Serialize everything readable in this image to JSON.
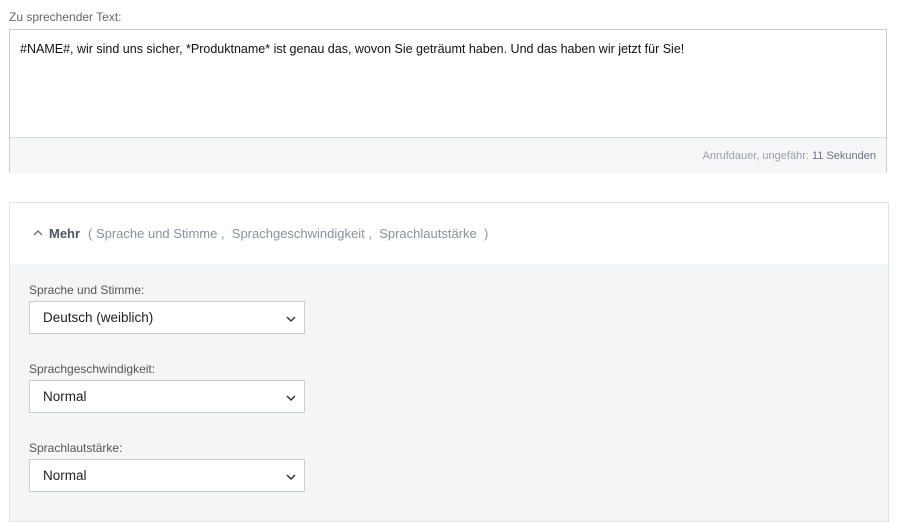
{
  "text_section": {
    "label": "Zu sprechender Text:",
    "text": "#NAME#, wir sind uns sicher, *Produktname* ist genau das, wovon Sie geträumt haben. Und das haben wir jetzt für Sie!",
    "duration_label": "Anrufdauer, ungefähr: ",
    "duration_value": "11 Sekunden"
  },
  "more": {
    "title": "Mehr",
    "summary": "( Sprache und Stimme ,  Sprachgeschwindigkeit ,  Sprachlautstärke  )",
    "expanded_icon": "chevron-up-icon"
  },
  "fields": [
    {
      "label": "Sprache und Stimme:",
      "value": "Deutsch (weiblich)",
      "icon": "chevron-down-icon"
    },
    {
      "label": "Sprachgeschwindigkeit:",
      "value": "Normal",
      "icon": "chevron-down-icon"
    },
    {
      "label": "Sprachlautstärke:",
      "value": "Normal",
      "icon": "chevron-down-icon"
    }
  ]
}
